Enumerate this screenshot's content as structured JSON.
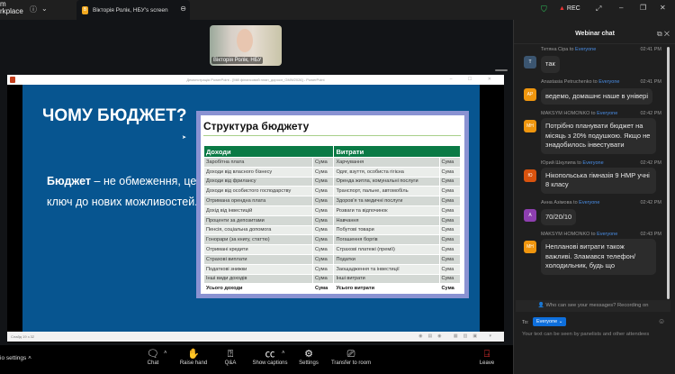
{
  "app": {
    "name_line1": "m",
    "name_line2": "rkplace"
  },
  "tab": {
    "icon_letter": "В",
    "label": "Вікторія Ролік, НБУ's screen"
  },
  "top": {
    "rec": "REC"
  },
  "video": {
    "name": "Вікторія Ролік, НБУ"
  },
  "ppt": {
    "title": "Демонстрація PowerPoint - [Мій фінансовий план_доросл_GMW2026] - PowerPoint",
    "status": "Слайд 19 з 32"
  },
  "slide": {
    "title": "ЧОМУ БЮДЖЕТ?",
    "body_bold": "Бюджет",
    "body_rest": " – не обмеження, це ключ до нових можливостей."
  },
  "table": {
    "title": "Структура бюджету",
    "headers": [
      "Доходи",
      "Витрати"
    ],
    "rows": [
      [
        "Заробітна плата",
        "Сума",
        "Харчування",
        "Сума"
      ],
      [
        "Доходи від власного бізнесу",
        "Сума",
        "Одяг, взуття, особиста гігієна",
        "Сума"
      ],
      [
        "Доходи від фрилансу",
        "Сума",
        "Оренда житла, комунальні послуги",
        "Сума"
      ],
      [
        "Доходи від особистого господарству",
        "Сума",
        "Транспорт, пальне, автомобіль",
        "Сума"
      ],
      [
        "Отримана орендна плата",
        "Сума",
        "Здоров'я та медичні послуги",
        "Сума"
      ],
      [
        "Дохід від інвестицій",
        "Сума",
        "Розваги та відпочинок",
        "Сума"
      ],
      [
        "Проценти за депозитами",
        "Сума",
        "Навчання",
        "Сума"
      ],
      [
        "Пенсія, соціальна допомога",
        "Сума",
        "Побутові товари",
        "Сума"
      ],
      [
        "Гонорари (за книгу, статтю)",
        "Сума",
        "Погашення боргів",
        "Сума"
      ],
      [
        "Отримані кредити",
        "Сума",
        "Страхові платежі (премії)",
        "Сума"
      ],
      [
        "Страхові виплати",
        "Сума",
        "Податки",
        "Сума"
      ],
      [
        "Податкові знижки",
        "Сума",
        "Заощадження та інвестиції",
        "Сума"
      ],
      [
        "Інші види доходів",
        "Сума",
        "Інші витрати",
        "Сума"
      ]
    ],
    "total": [
      "Усього доходи",
      "Сума",
      "Усього витрати",
      "Сума"
    ]
  },
  "toolbar": {
    "audio": "io settings",
    "chat": "Chat",
    "raise": "Raise hand",
    "qa": "Q&A",
    "captions": "Show captions",
    "settings": "Settings",
    "transfer": "Transfer to room",
    "leave": "Leave"
  },
  "chat": {
    "title": "Webinar chat",
    "messages": [
      {
        "sender": "Тетяна Сіра",
        "to": "Everyone",
        "time": "02:41 PM",
        "initials": "Т",
        "color": "#3b5570",
        "text": "так"
      },
      {
        "sender": "Anastasia Petruchenko",
        "to": "Everyone",
        "time": "02:41 PM",
        "initials": "AP",
        "color": "#f0960e",
        "text": "ведемо, домашнє наше в універі"
      },
      {
        "sender": "MAKSYM HOMONKO",
        "to": "Everyone",
        "time": "02:42 PM",
        "initials": "MH",
        "color": "#f0960e",
        "text": "Потрібно планувати бюджет на місяць з 20% подушкою. Якщо не знадобилось інвестувати"
      },
      {
        "sender": "Юрий Шкулипа",
        "to": "Everyone",
        "time": "02:42 PM",
        "initials": "Ю",
        "color": "#d9530e",
        "text": "Нікопольська гімназія 9 НМР учні 8 класу"
      },
      {
        "sender": "Анна Азімова",
        "to": "Everyone",
        "time": "02:42 PM",
        "initials": "А",
        "color": "#8e3fb0",
        "text": "70/20/10"
      },
      {
        "sender": "MAKSYM HOMONKO",
        "to": "Everyone",
        "time": "02:43 PM",
        "initials": "MH",
        "color": "#f0960e",
        "text": "Непланові витрати також важливі. Зламався телефон/холодильник, будь що"
      }
    ],
    "to_word": " to ",
    "who": "Who can see your messages? Recording on",
    "to_label": "To:",
    "to_value": "Everyone ⌄",
    "hint": "Your text can be seen by panelists and other attendees"
  }
}
